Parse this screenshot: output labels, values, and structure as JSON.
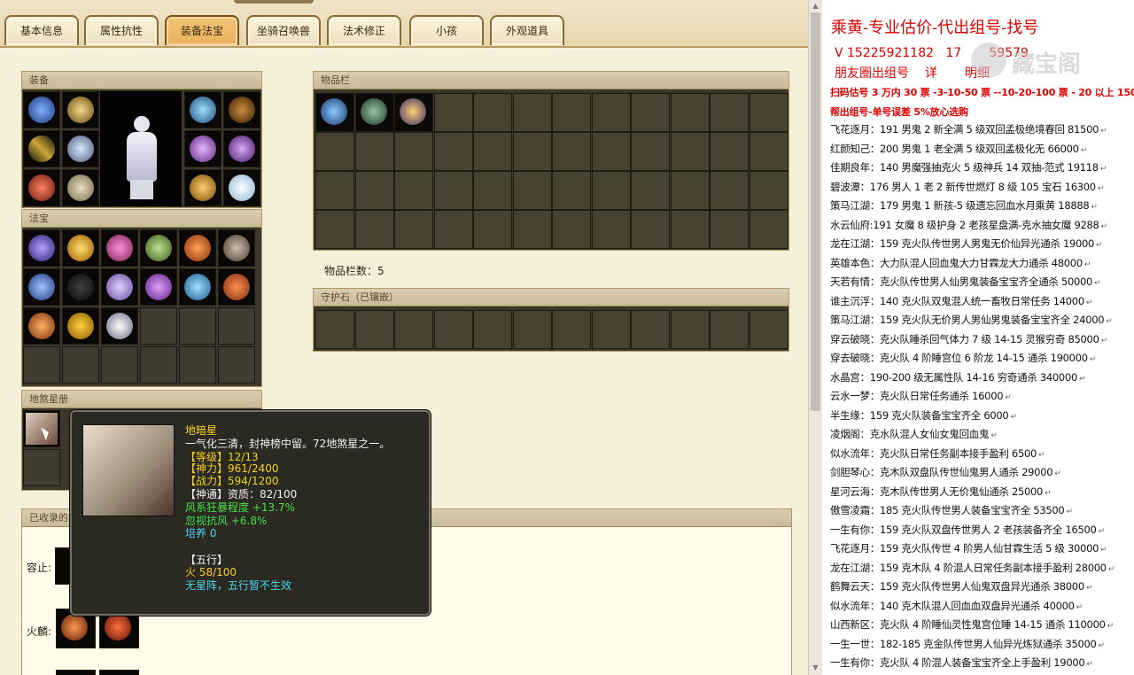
{
  "tabs": [
    "基本信息",
    "属性抗性",
    "装备法宝",
    "坐骑召唤兽",
    "法术修正",
    "小孩",
    "外观道具"
  ],
  "active_tab": "装备法宝",
  "sections": {
    "equipment": "装备",
    "fabao": "法宝",
    "dishaxing": "地煞星册",
    "items": "物品栏",
    "guard": "守护石（已镶嵌）",
    "collected": "已收录的"
  },
  "items_count_label": "物品栏数：5",
  "side_labels": {
    "rongzhi": "容止:",
    "huolin": "火麟:"
  },
  "tooltip": {
    "name": "地暗星",
    "desc": "一气化三清，封神榜中留。72地煞星之一。",
    "level": "【等级】12/13",
    "shenli": "【神力】961/2400",
    "zhanli": "【战力】594/1200",
    "shentong": "【神通】资质：82/100",
    "effect1": "风系狂暴程度 +13.7%",
    "effect2": "忽视抗风 +6.8%",
    "peiyang": "培养 0",
    "wuxing_title": "【五行】",
    "wuxing_val": "火 58/100",
    "wuxing_note": "无星阵，五行暂不生效"
  },
  "right": {
    "title": "乘黄-专业估价-代出组号-找号",
    "phone": "V 15225921182",
    "phone2": "1",
    "phone3": "7",
    "phone4": "59579",
    "friends": "朋友圈出组号",
    "friends2": "详",
    "friends3": "明细",
    "line1": "扫码估号 3 万内 30 票 -3-10-50 票 --10-20-100 票 - 20 以上 150",
    "line2": "帮出组号-单号误差 5%放心选购",
    "watermark": "藏宝阁",
    "rows": [
      "飞花逐月：191 男鬼 2 新全满 5 级双回孟极绝境春回 81500",
      "红颜知己：200 男鬼 1 老全满 5 级双回孟极化无 66000",
      "佳期良年：140 男魔强抽克火 5 级神兵 14 双抽-范式 19118",
      "碧波潭：176 男人 1 老 2 新传世燃灯 8 级 105 宝石 16300",
      "策马江湖：179 男鬼 1 新孩-5 级遗忘回血水月乘黄 18888",
      "水云仙府:191 女魔 8 级护身 2 老孩星盘满-克水抽女魔 9288",
      "龙在江湖：159 克火队传世男人男鬼无价仙异光通杀 19000",
      "英雄本色：大力队混人回血鬼大力甘霖龙大力通杀 48000",
      "天若有情：克火队传世男人仙男鬼装备宝宝齐全通杀 50000",
      "谁主沉浮：140 克火队双鬼混人统一畜牧日常任务 14000",
      "策马江湖：159 克火队无价男人男仙男鬼装备宝宝齐全 24000",
      "穿云破晓：克火队睡杀回气体力 7 级 14-15 灵猴穷奇 85000",
      "穿去破晓：克火队 4 阶睡宫位 6 阶龙 14-15 通杀 190000",
      "水晶宫：190-200 级无属性队 14-16 穷奇通杀 340000",
      "云水一梦：克火队日常任务通杀 16000",
      "半生缘：159 克火队装备宝宝齐全 6000",
      "凌烟阁：克水队混人女仙女鬼回血鬼",
      "似水流年：克火队日常任务副本接手盈利 6500",
      "剑胆琴心：克木队双盘队传世仙鬼男人通杀 29000",
      "星河云海：克木队传世男人无价鬼仙通杀 25000",
      "傲雪凌霜：185 克火队传世男人装备宝宝齐全 53500",
      "一生有你：159 克火队双盘传世男人 2 老孩装备齐全 16500",
      "飞花逐月：159 克火队传世 4 阶男人仙甘霖生活 5 级 30000",
      "龙在江湖：159 克木队 4 阶混人日常任务副本接手盈利 28000",
      "鹤舞云天：159 克火队传世男人仙鬼双盘异光通杀 38000",
      "似水流年：140 克木队混人回血血双盘异光通杀 40000",
      "山西新区：克火队 4 阶睡仙灵性鬼宫位睡 14-15 通杀 110000",
      "一生一世：182-185 克金队传世男人仙异光炼狱通杀 35000",
      "一生有你：克火队 4 阶混人装备宝宝齐全上手盈利 19000"
    ]
  },
  "colors": {
    "accent": "#e00000",
    "tab_active": "#e9b05c",
    "panel": "#3d372a",
    "tooltip_bg": "#2b2a22"
  }
}
